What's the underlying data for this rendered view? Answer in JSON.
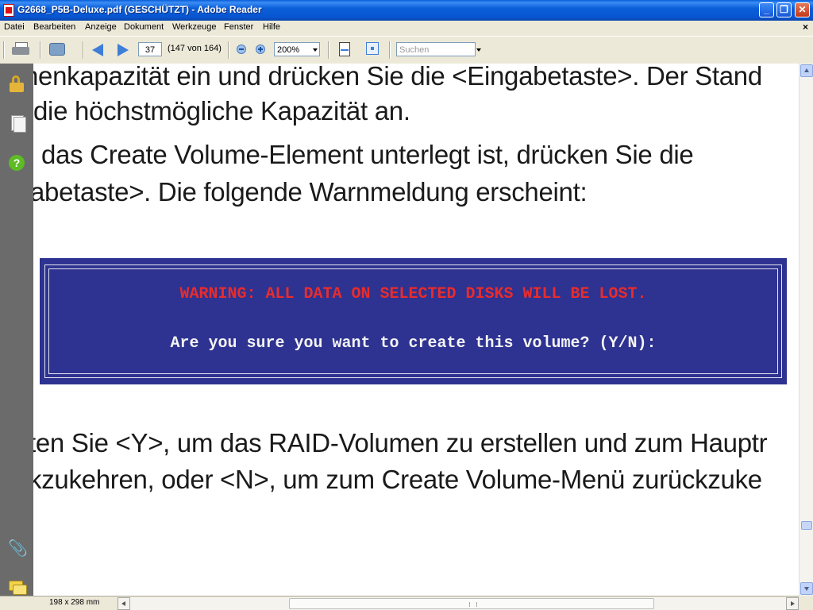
{
  "window": {
    "title": "G2668_P5B-Deluxe.pdf (GESCHÜTZT) - Adobe Reader"
  },
  "menu": {
    "items": [
      "Datei",
      "Bearbeiten",
      "Anzeige",
      "Dokument",
      "Werkzeuge",
      "Fenster",
      "Hilfe"
    ],
    "close_glyph": "×"
  },
  "toolbar": {
    "page_number": "37",
    "page_count": "(147 von 164)",
    "zoom": "200%",
    "search_placeholder": "Suchen"
  },
  "document": {
    "lines": [
      "henkapazität ein und drücken Sie die <Eingabetaste>. Der Stand",
      "die höchstmögliche Kapazität an.",
      "das Create Volume-Element unterlegt ist, drücken Sie die",
      "abetaste>. Die folgende Warnmeldung erscheint:",
      "ten Sie <Y>, um das RAID-Volumen zu erstellen und zum Hauptr",
      "kzukehren, oder <N>, um zum Create Volume-Menü zurückzuke"
    ],
    "warning_box": {
      "warning": "WARNING: ALL DATA ON SELECTED DISKS WILL BE LOST.",
      "question": "Are you sure you want to create this volume? (Y/N):"
    }
  },
  "status": {
    "page_size": "198 x 298 mm"
  },
  "colors": {
    "warning_box_bg": "#2e3291",
    "warning_red": "#e82c2c",
    "nav_panel_bg": "#6b6b6b"
  }
}
